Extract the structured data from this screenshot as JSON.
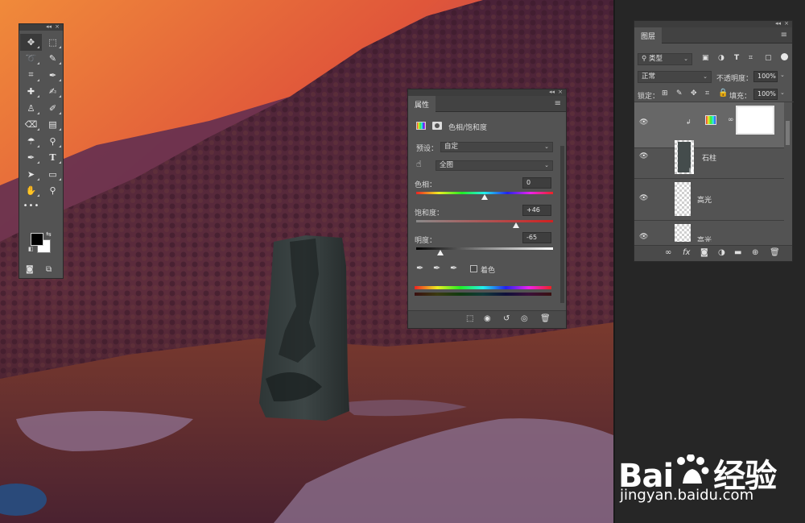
{
  "colors": {
    "panel_bg": "#535353",
    "panel_header": "#424242",
    "selected_row": "#676767",
    "foreground_color": "#000000",
    "background_color": "#ffffff",
    "sky_top": "#e0603a",
    "mountain": "#5c2a3e"
  },
  "toolbar": {
    "tools": [
      {
        "icon": "move-icon",
        "glyph": "✥"
      },
      {
        "icon": "marquee-icon",
        "glyph": "⬚"
      },
      {
        "icon": "lasso-icon",
        "glyph": "➰"
      },
      {
        "icon": "quick-select-icon",
        "glyph": "✎"
      },
      {
        "icon": "crop-icon",
        "glyph": "⌗"
      },
      {
        "icon": "eyedropper-icon",
        "glyph": "✒"
      },
      {
        "icon": "healing-brush-icon",
        "glyph": "✚"
      },
      {
        "icon": "brush-icon",
        "glyph": "✍"
      },
      {
        "icon": "clone-stamp-icon",
        "glyph": "♙"
      },
      {
        "icon": "history-brush-icon",
        "glyph": "✐"
      },
      {
        "icon": "eraser-icon",
        "glyph": "⌫"
      },
      {
        "icon": "gradient-icon",
        "glyph": "▤"
      },
      {
        "icon": "blur-icon",
        "glyph": "☂"
      },
      {
        "icon": "dodge-icon",
        "glyph": "⚲"
      },
      {
        "icon": "pen-icon",
        "glyph": "✒"
      },
      {
        "icon": "type-icon",
        "glyph": "T"
      },
      {
        "icon": "path-select-icon",
        "glyph": "➤"
      },
      {
        "icon": "rectangle-icon",
        "glyph": "▭"
      },
      {
        "icon": "hand-icon",
        "glyph": "✋"
      },
      {
        "icon": "zoom-icon",
        "glyph": "⚲"
      }
    ],
    "more": "•••"
  },
  "properties": {
    "tab": "属性",
    "adjustment_name": "色相/饱和度",
    "preset_label": "预设：",
    "preset_value": "自定",
    "channel_value": "全图",
    "hue_label": "色相：",
    "hue_value": "0",
    "saturation_label": "饱和度：",
    "saturation_value": "+46",
    "lightness_label": "明度：",
    "lightness_value": "-65",
    "colorize_label": "着色",
    "hue": 0,
    "saturation": 46,
    "lightness": -65
  },
  "layers": {
    "tab": "图层",
    "filter_kind": "类型",
    "blend_mode": "正常",
    "opacity_label": "不透明度：",
    "opacity_value": "100%",
    "lock_label": "锁定：",
    "fill_label": "填充：",
    "fill_value": "100%",
    "items": [
      {
        "name": "",
        "type": "adjustment-with-mask",
        "selected": true
      },
      {
        "name": "石柱",
        "type": "pixel",
        "selected": false
      },
      {
        "name": "高光",
        "type": "pixel",
        "selected": false
      },
      {
        "name": "高光",
        "type": "pixel",
        "selected": false
      }
    ]
  },
  "watermark": {
    "brand_left": "Bai",
    "brand_right": "经验",
    "site": "jingyan.baidu.com"
  }
}
